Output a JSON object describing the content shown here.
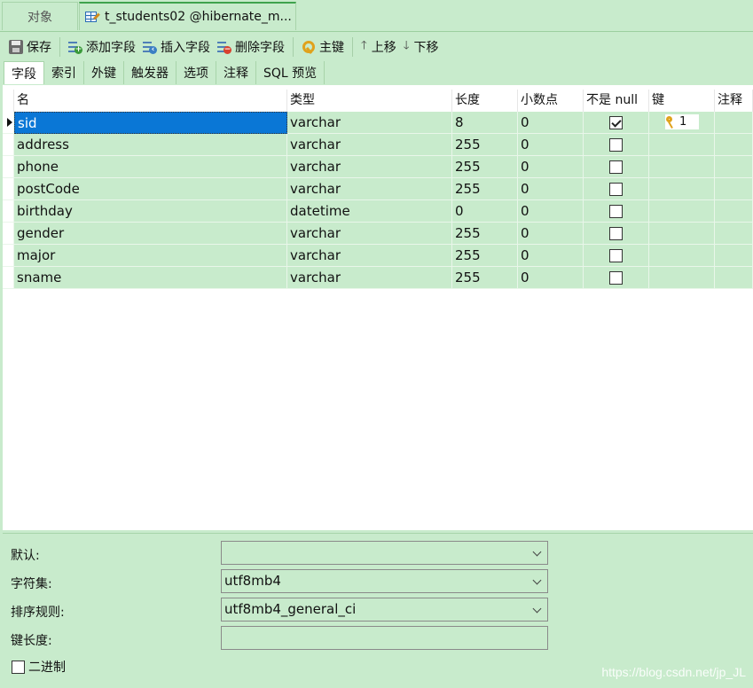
{
  "window_tabs": {
    "objects_label": "对象",
    "active_label": "t_students02 @hibernate_m..."
  },
  "toolbar": {
    "save": "保存",
    "add_field": "添加字段",
    "insert_field": "插入字段",
    "delete_field": "删除字段",
    "primary_key": "主键",
    "move_up": "上移",
    "move_down": "下移"
  },
  "subtabs": [
    "字段",
    "索引",
    "外键",
    "触发器",
    "选项",
    "注释",
    "SQL 预览"
  ],
  "grid": {
    "headers": {
      "name": "名",
      "type": "类型",
      "length": "长度",
      "decimals": "小数点",
      "not_null": "不是 null",
      "key": "键",
      "comment": "注释"
    },
    "rows": [
      {
        "name": "sid",
        "type": "varchar",
        "length": "8",
        "decimals": "0",
        "not_null": true,
        "key": "1"
      },
      {
        "name": "address",
        "type": "varchar",
        "length": "255",
        "decimals": "0",
        "not_null": false,
        "key": ""
      },
      {
        "name": "phone",
        "type": "varchar",
        "length": "255",
        "decimals": "0",
        "not_null": false,
        "key": ""
      },
      {
        "name": "postCode",
        "type": "varchar",
        "length": "255",
        "decimals": "0",
        "not_null": false,
        "key": ""
      },
      {
        "name": "birthday",
        "type": "datetime",
        "length": "0",
        "decimals": "0",
        "not_null": false,
        "key": ""
      },
      {
        "name": "gender",
        "type": "varchar",
        "length": "255",
        "decimals": "0",
        "not_null": false,
        "key": ""
      },
      {
        "name": "major",
        "type": "varchar",
        "length": "255",
        "decimals": "0",
        "not_null": false,
        "key": ""
      },
      {
        "name": "sname",
        "type": "varchar",
        "length": "255",
        "decimals": "0",
        "not_null": false,
        "key": ""
      }
    ]
  },
  "properties": {
    "default_label": "默认:",
    "default_value": "",
    "charset_label": "字符集:",
    "charset_value": "utf8mb4",
    "collation_label": "排序规则:",
    "collation_value": "utf8mb4_general_ci",
    "key_length_label": "键长度:",
    "key_length_value": "",
    "binary_label": "二进制"
  },
  "watermark": "https://blog.csdn.net/jp_JL",
  "colors": {
    "background": "#c8ebcc",
    "selection": "#0a77d6",
    "key_icon": "#e0a21c"
  }
}
